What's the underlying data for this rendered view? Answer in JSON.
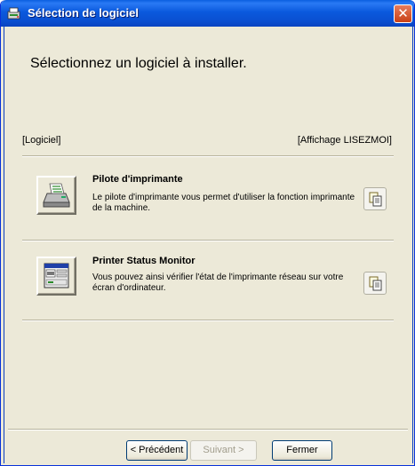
{
  "window": {
    "title": "Sélection de logiciel",
    "close_glyph": "✕",
    "icons": {
      "app": "installer-icon",
      "close": "close-icon"
    }
  },
  "main": {
    "heading": "Sélectionnez un logiciel à installer.",
    "label_left": "[Logiciel]",
    "label_right": "[Affichage LISEZMOI]"
  },
  "items": [
    {
      "title": "Pilote d'imprimante",
      "description": "Le pilote d'imprimante vous permet d'utiliser la fonction imprimante de la machine.",
      "icon": "printer-icon",
      "readme_icon": "document-copy-icon"
    },
    {
      "title": "Printer Status Monitor",
      "description": "Vous pouvez ainsi vérifier l'état de l'imprimante réseau sur votre écran d'ordinateur.",
      "icon": "status-monitor-icon",
      "readme_icon": "document-copy-icon"
    }
  ],
  "footer": {
    "prev_label": "< Précédent",
    "next_label": "Suivant >",
    "close_label": "Fermer"
  },
  "colors": {
    "titlebar": "#0a59dd",
    "dialog_bg": "#ece9d8",
    "close_button": "#c94016",
    "disabled_text": "#a19d8c"
  }
}
